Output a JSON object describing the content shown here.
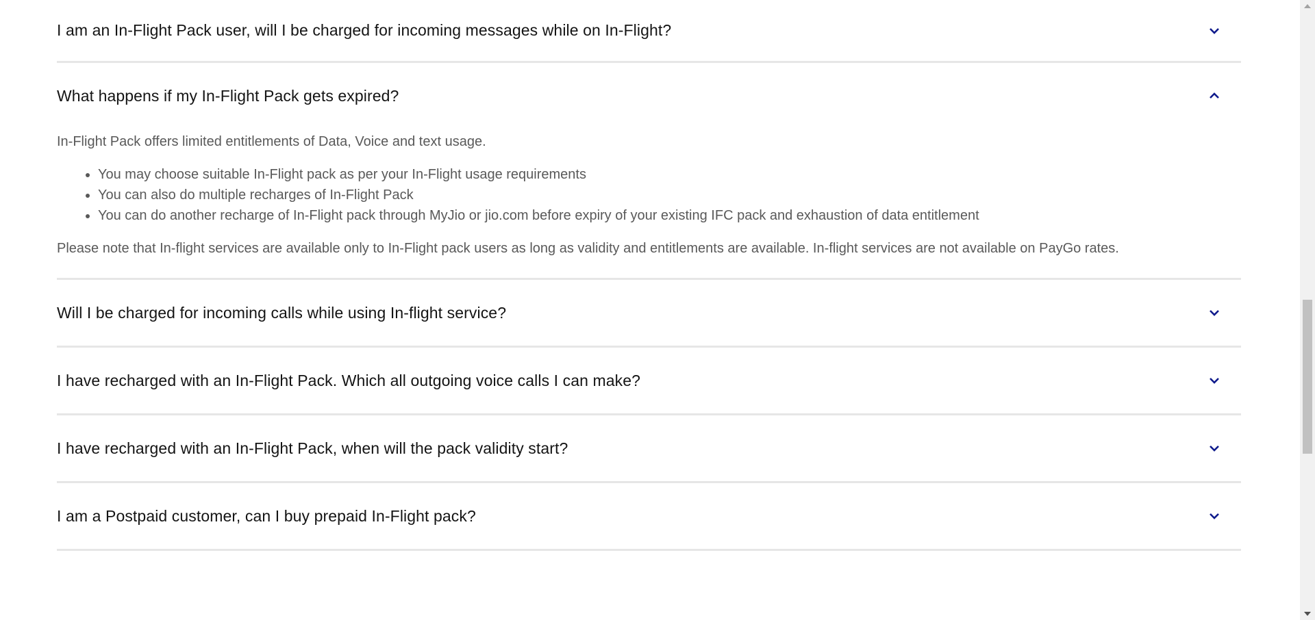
{
  "faq": {
    "items": [
      {
        "question": "I am an In-Flight Pack user, will I be charged for incoming messages while on In-Flight?",
        "expanded": false
      },
      {
        "question": "What happens if my In-Flight Pack gets expired?",
        "expanded": true,
        "answer": {
          "intro": "In-Flight Pack offers limited entitlements of Data, Voice and text usage.",
          "bullets": [
            "You may choose suitable In-Flight pack as per your In-Flight usage requirements",
            "You can also do multiple recharges of In-Flight Pack",
            "You can do another recharge of In-Flight pack through MyJio or jio.com before expiry of your existing IFC pack and exhaustion of data entitlement"
          ],
          "note": "Please note that In-flight services are available only to In-Flight pack users as long as validity and entitlements are available. In-flight services are not available on PayGo rates."
        }
      },
      {
        "question": "Will I be charged for incoming calls while using In-flight service?",
        "expanded": false
      },
      {
        "question": "I have recharged with an In-Flight Pack. Which all outgoing voice calls I can make?",
        "expanded": false
      },
      {
        "question": "I have recharged with an In-Flight Pack, when will the pack validity start?",
        "expanded": false
      },
      {
        "question": "I am a Postpaid customer, can I buy prepaid In-Flight pack?",
        "expanded": false
      }
    ]
  },
  "icons": {
    "collapsed": "chevron-down-icon",
    "expanded": "chevron-up-icon"
  },
  "colors": {
    "chevron": "#0f1b8c",
    "divider": "#e6e6e6",
    "question": "#141414",
    "answer": "#595959"
  }
}
